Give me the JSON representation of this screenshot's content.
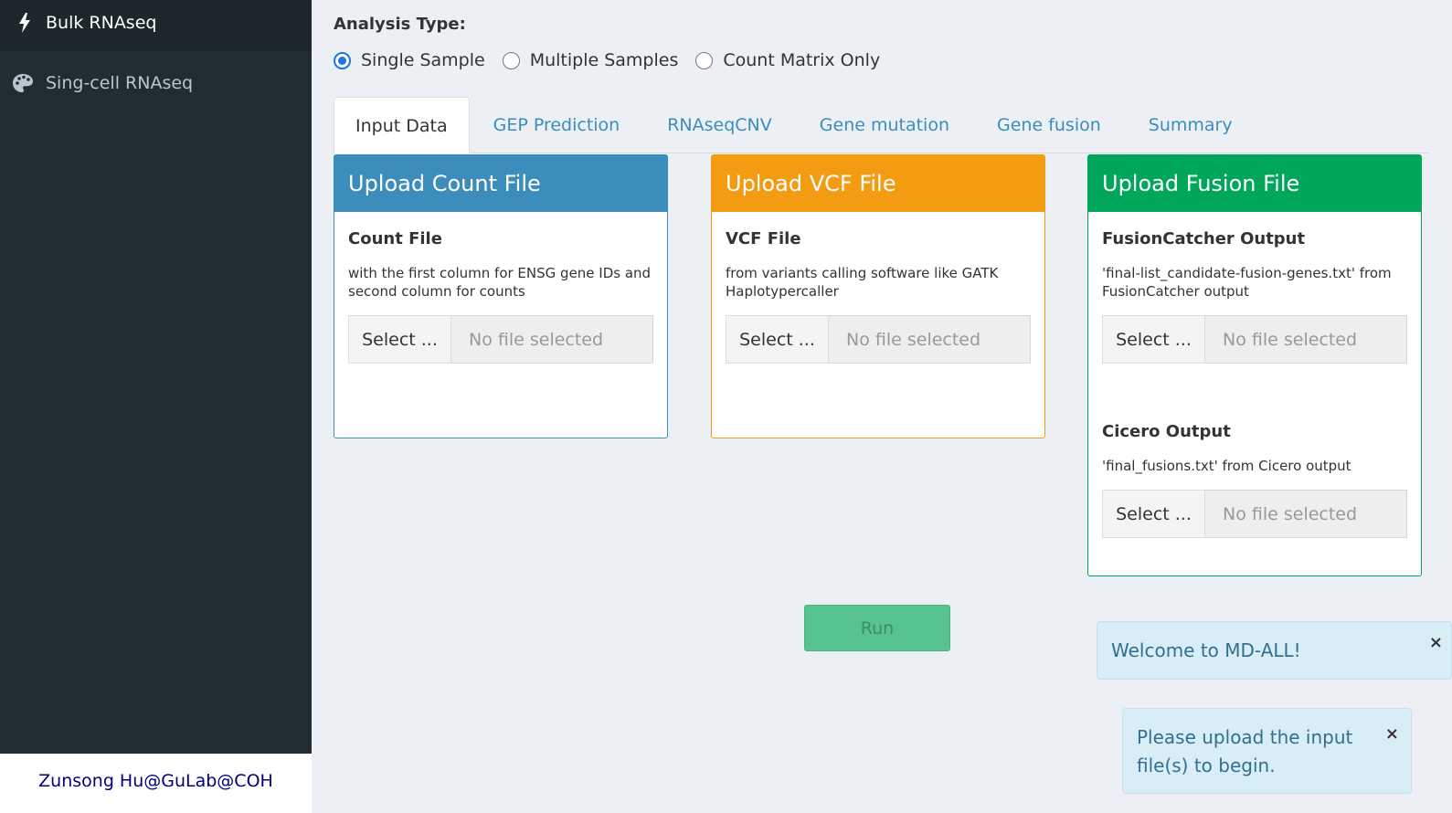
{
  "sidebar": {
    "items": [
      {
        "label": "Bulk RNAseq",
        "icon": "bolt-icon",
        "active": true
      },
      {
        "label": "Sing-cell RNAseq",
        "icon": "palette-icon",
        "active": false
      }
    ],
    "footer": "Zunsong Hu@GuLab@COH"
  },
  "analysis": {
    "label": "Analysis Type:",
    "options": [
      "Single Sample",
      "Multiple Samples",
      "Count Matrix Only"
    ],
    "selected": "Single Sample"
  },
  "tabs": [
    "Input Data",
    "GEP Prediction",
    "RNAseqCNV",
    "Gene mutation",
    "Gene fusion",
    "Summary"
  ],
  "active_tab": "Input Data",
  "boxes": [
    {
      "title": "Upload Count File",
      "color": "#3c8dbc",
      "fields": [
        {
          "label": "Count File",
          "desc": "with the first column for ENSG gene IDs and second column for counts",
          "button": "Select ...",
          "placeholder": "No file selected"
        }
      ]
    },
    {
      "title": "Upload VCF File",
      "color": "#f39c12",
      "fields": [
        {
          "label": "VCF File",
          "desc": "from variants calling software like GATK Haplotypercaller",
          "button": "Select ...",
          "placeholder": "No file selected"
        }
      ]
    },
    {
      "title": "Upload Fusion File",
      "color": "#00a65a",
      "fields": [
        {
          "label": "FusionCatcher Output",
          "desc": "'final-list_candidate-fusion-genes.txt' from FusionCatcher output",
          "button": "Select ...",
          "placeholder": "No file selected"
        },
        {
          "label": "Cicero Output",
          "desc": "'final_fusions.txt' from Cicero output",
          "button": "Select ...",
          "placeholder": "No file selected"
        }
      ]
    }
  ],
  "run_button": "Run",
  "notifications": [
    {
      "text": "Welcome to MD-ALL!",
      "close": "×"
    },
    {
      "text": "Please upload the input file(s) to begin.",
      "close": "×"
    }
  ]
}
